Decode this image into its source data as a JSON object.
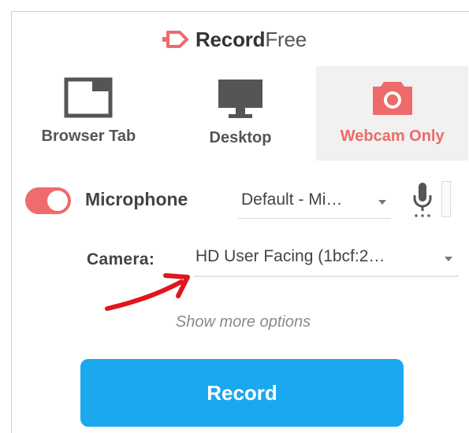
{
  "header": {
    "brand_bold": "Record",
    "brand_light": "Free",
    "logo_icon": "recordfree-logo-icon"
  },
  "modes": [
    {
      "label": "Browser Tab",
      "icon": "browser-tab-icon",
      "selected": false
    },
    {
      "label": "Desktop",
      "icon": "desktop-monitor-icon",
      "selected": false
    },
    {
      "label": "Webcam Only",
      "icon": "camera-icon",
      "selected": true
    }
  ],
  "microphone": {
    "label": "Microphone",
    "enabled": true,
    "selected_value": "Default - Mi…",
    "icon": "microphone-icon"
  },
  "camera": {
    "label": "Camera:",
    "selected_value": "HD User Facing (1bcf:2…"
  },
  "more_options": "Show more options",
  "record_button": "Record",
  "colors": {
    "accent_red": "#ef6a6a",
    "record_blue": "#1aa8ef",
    "annotation_arrow": "#e0161d"
  }
}
